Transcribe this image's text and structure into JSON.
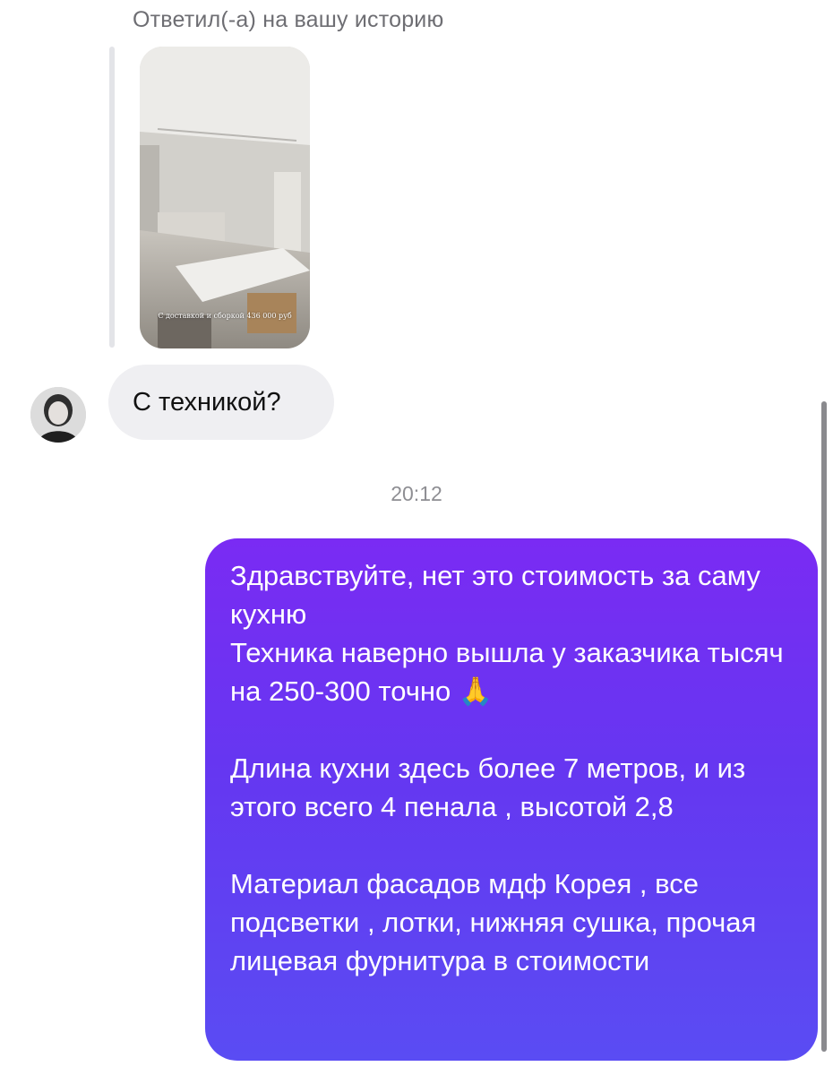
{
  "conversation": {
    "reply_label": "Ответил(-а) на вашу историю",
    "story": {
      "caption": "С доставкой и сборкой 436 000 руб"
    },
    "incoming_message": {
      "text": "С техникой?"
    },
    "timestamp": "20:12",
    "outgoing_message": {
      "text": "Здравствуйте, нет это стоимость за саму кухню\nТехника наверно вышла у заказчика тысяч на 250-300 точно 🙏\n\nДлина  кухни здесь более 7 метров, и из этого всего 4 пенала , высотой 2,8\n\nМатериал фасадов мдф Корея , все подсветки , лотки, нижняя сушка, прочая лицевая фурнитура в стоимости"
    }
  },
  "colors": {
    "outgoing_gradient_top": "#7a2bf3",
    "outgoing_gradient_bottom": "#5a4cf3",
    "incoming_bubble": "#efeff2",
    "meta_text": "#8e8e93"
  }
}
